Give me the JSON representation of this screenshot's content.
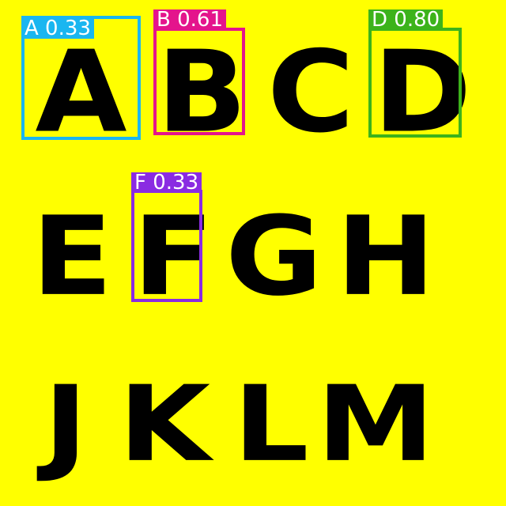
{
  "letters": [
    "A",
    "B",
    "C",
    "D",
    "E",
    "F",
    "G",
    "H",
    "J",
    "K",
    "L",
    "M"
  ],
  "background_color": "#ffff00",
  "letter_color": "#000000",
  "detections": [
    {
      "label": "A 0.33",
      "class": "A",
      "score": 0.33,
      "color": "#1ab6f0"
    },
    {
      "label": "B 0.61",
      "class": "B",
      "score": 0.61,
      "color": "#e4148c"
    },
    {
      "label": "D 0.80",
      "class": "D",
      "score": 0.8,
      "color": "#3cb31a"
    },
    {
      "label": "F 0.33",
      "class": "F",
      "score": 0.33,
      "color": "#8a2be2"
    }
  ]
}
